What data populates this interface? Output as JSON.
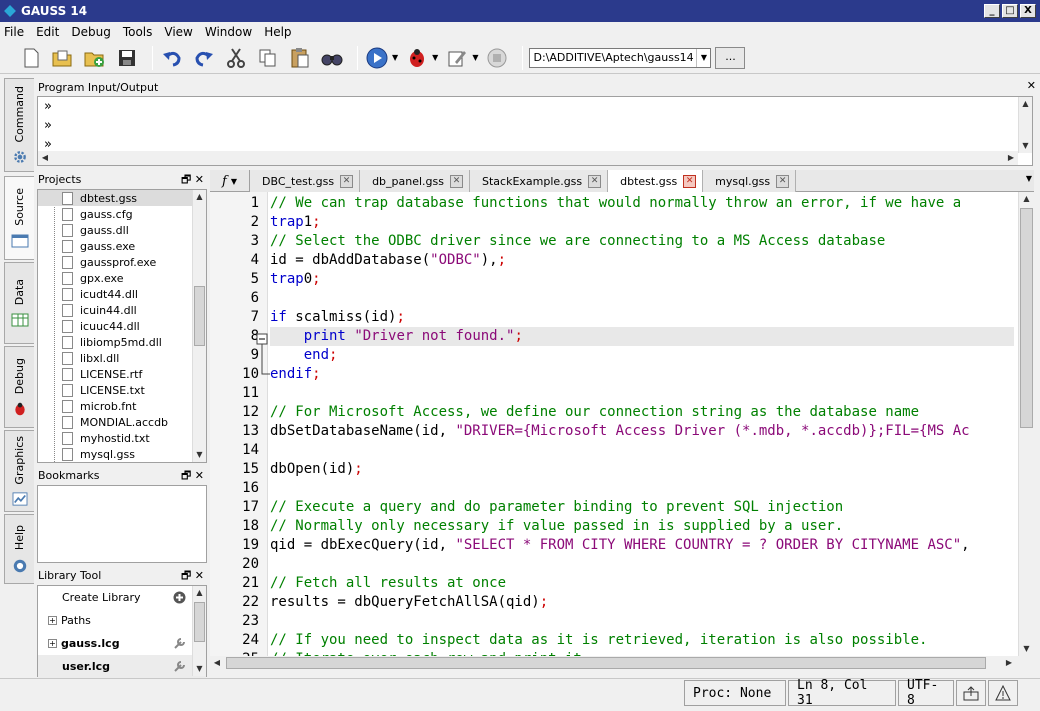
{
  "app": {
    "title": "GAUSS 14"
  },
  "window_buttons": [
    "_",
    "□",
    "X"
  ],
  "menu": [
    "File",
    "Edit",
    "Debug",
    "Tools",
    "View",
    "Window",
    "Help"
  ],
  "toolbar": {
    "icons": [
      "new-file-icon",
      "open-file-icon",
      "open-project-icon",
      "save-icon",
      "undo-icon",
      "redo-icon",
      "cut-icon",
      "copy-icon",
      "paste-icon",
      "find-icon",
      "run-icon",
      "debug-icon",
      "edit-icon",
      "stop-icon"
    ],
    "working_dir": "D:\\ADDITIVE\\Aptech\\gauss14",
    "browse_label": "..."
  },
  "sidebar": {
    "tabs": [
      "Command",
      "Source",
      "Data",
      "Debug",
      "Graphics",
      "Help"
    ],
    "active": "Source"
  },
  "program_io": {
    "title": "Program Input/Output",
    "close": "✕",
    "prompts": [
      "»",
      "»",
      "»"
    ]
  },
  "projects": {
    "title": "Projects",
    "buttons": "🗗 ✕",
    "files": [
      "dbtest.gss",
      "gauss.cfg",
      "gauss.dll",
      "gauss.exe",
      "gaussprof.exe",
      "gpx.exe",
      "icudt44.dll",
      "icuin44.dll",
      "icuuc44.dll",
      "libiomp5md.dll",
      "libxl.dll",
      "LICENSE.rtf",
      "LICENSE.txt",
      "microb.fnt",
      "MONDIAL.accdb",
      "myhostid.txt",
      "mysql.gss"
    ],
    "selected": "dbtest.gss"
  },
  "bookmarks": {
    "title": "Bookmarks",
    "buttons": "🗗 ✕"
  },
  "library": {
    "title": "Library Tool",
    "buttons": "🗗 ✕",
    "items": [
      {
        "label": "Create Library",
        "expander": "",
        "bold": false,
        "icon": "add-icon"
      },
      {
        "label": "Paths",
        "expander": "+",
        "bold": false,
        "icon": ""
      },
      {
        "label": "gauss.lcg",
        "expander": "+",
        "bold": true,
        "icon": "wrench-icon"
      },
      {
        "label": "user.lcg",
        "expander": "",
        "bold": true,
        "icon": "wrench-icon"
      }
    ]
  },
  "editor": {
    "function_tab": "f",
    "tabs": [
      {
        "label": "DBC_test.gss",
        "active": false
      },
      {
        "label": "db_panel.gss",
        "active": false
      },
      {
        "label": "StackExample.gss",
        "active": false
      },
      {
        "label": "dbtest.gss",
        "active": true
      },
      {
        "label": "mysql.gss",
        "active": false
      }
    ],
    "current_line": 8,
    "lines": [
      {
        "n": "1",
        "parts": [
          [
            "c-com",
            "// We can trap database functions that would normally throw an error, if we have a"
          ]
        ]
      },
      {
        "n": "2",
        "parts": [
          [
            "c-kw",
            "trap"
          ],
          [
            "",
            "1"
          ],
          [
            "c-pun",
            ";"
          ]
        ]
      },
      {
        "n": "3",
        "parts": [
          [
            "c-com",
            "// Select the ODBC driver since we are connecting to a MS Access database"
          ]
        ]
      },
      {
        "n": "4",
        "parts": [
          [
            "",
            "id = dbAddDatabase("
          ],
          [
            "c-str",
            "\"ODBC\""
          ],
          [
            "",
            "),"
          ],
          [
            "c-pun",
            ";"
          ]
        ]
      },
      {
        "n": "5",
        "parts": [
          [
            "c-kw",
            "trap"
          ],
          [
            "",
            "0"
          ],
          [
            "c-pun",
            ";"
          ]
        ]
      },
      {
        "n": "6",
        "parts": []
      },
      {
        "n": "7",
        "parts": [
          [
            "c-kw",
            "if"
          ],
          [
            "",
            " scalmiss(id)"
          ],
          [
            "c-pun",
            ";"
          ]
        ]
      },
      {
        "n": "8",
        "parts": [
          [
            "",
            "    "
          ],
          [
            "c-kw",
            "print"
          ],
          [
            "",
            " "
          ],
          [
            "c-str",
            "\"Driver not found.\""
          ],
          [
            "c-pun",
            ";"
          ]
        ]
      },
      {
        "n": "9",
        "parts": [
          [
            "",
            "    "
          ],
          [
            "c-kw",
            "end"
          ],
          [
            "c-pun",
            ";"
          ]
        ]
      },
      {
        "n": "10",
        "parts": [
          [
            "c-kw",
            "endif"
          ],
          [
            "c-pun",
            ";"
          ]
        ]
      },
      {
        "n": "11",
        "parts": []
      },
      {
        "n": "12",
        "parts": [
          [
            "c-com",
            "// For Microsoft Access, we define our connection string as the database name"
          ]
        ]
      },
      {
        "n": "13",
        "parts": [
          [
            "",
            "dbSetDatabaseName(id, "
          ],
          [
            "c-str",
            "\"DRIVER={Microsoft Access Driver (*.mdb, *.accdb)};FIL={MS Ac"
          ]
        ]
      },
      {
        "n": "14",
        "parts": []
      },
      {
        "n": "15",
        "parts": [
          [
            "",
            "dbOpen(id)"
          ],
          [
            "c-pun",
            ";"
          ]
        ]
      },
      {
        "n": "16",
        "parts": []
      },
      {
        "n": "17",
        "parts": [
          [
            "c-com",
            "// Execute a query and do parameter binding to prevent SQL injection"
          ]
        ]
      },
      {
        "n": "18",
        "parts": [
          [
            "c-com",
            "// Normally only necessary if value passed in is supplied by a user."
          ]
        ]
      },
      {
        "n": "19",
        "parts": [
          [
            "",
            "qid = dbExecQuery(id, "
          ],
          [
            "c-str",
            "\"SELECT * FROM CITY WHERE COUNTRY = ? ORDER BY CITYNAME ASC\""
          ],
          [
            "",
            ","
          ]
        ]
      },
      {
        "n": "20",
        "parts": []
      },
      {
        "n": "21",
        "parts": [
          [
            "c-com",
            "// Fetch all results at once"
          ]
        ]
      },
      {
        "n": "22",
        "parts": [
          [
            "",
            "results = dbQueryFetchAllSA(qid)"
          ],
          [
            "c-pun",
            ";"
          ]
        ]
      },
      {
        "n": "23",
        "parts": []
      },
      {
        "n": "24",
        "parts": [
          [
            "c-com",
            "// If you need to inspect data as it is retrieved, iteration is also possible."
          ]
        ]
      },
      {
        "n": "25",
        "parts": [
          [
            "c-com",
            "// Iterate over each row and print it"
          ]
        ]
      }
    ]
  },
  "status": {
    "proc": "Proc: None",
    "position": "Ln 8, Col 31",
    "encoding": "UTF-8"
  }
}
